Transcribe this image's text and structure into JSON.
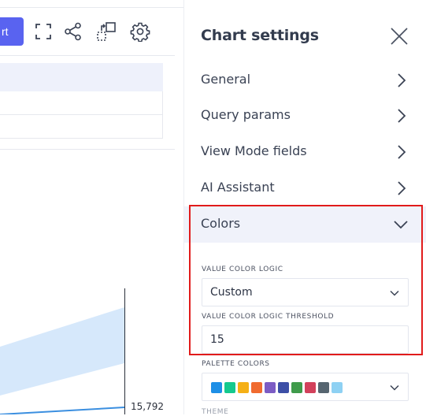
{
  "toolbar": {
    "primary_button_label": "rt",
    "icons": [
      "fullscreen-icon",
      "share-icon",
      "export-icon",
      "gear-icon"
    ]
  },
  "chart": {
    "data_label": "15,792",
    "line_color": "#3b8fe0",
    "band_color": "#d6e8fb"
  },
  "panel": {
    "title": "Chart settings",
    "sections": [
      {
        "label": "General",
        "expanded": false
      },
      {
        "label": "Query params",
        "expanded": false
      },
      {
        "label": "View Mode fields",
        "expanded": false
      },
      {
        "label": "AI Assistant",
        "expanded": false
      },
      {
        "label": "Colors",
        "expanded": true
      }
    ],
    "colors": {
      "value_color_logic_label": "VALUE COLOR LOGIC",
      "value_color_logic_value": "Custom",
      "threshold_label": "VALUE COLOR LOGIC THRESHOLD",
      "threshold_value": "15",
      "palette_label": "PALETTE COLORS",
      "palette": [
        "#1e8fe6",
        "#14c98e",
        "#f5b016",
        "#f06b2f",
        "#7c5cc4",
        "#3d4fa6",
        "#3f9b4b",
        "#d2415b",
        "#566570",
        "#8ed1f3"
      ],
      "next_label": "THEME"
    }
  },
  "accent": {
    "primary": "#5963f0",
    "highlight": "#e11b1b"
  }
}
